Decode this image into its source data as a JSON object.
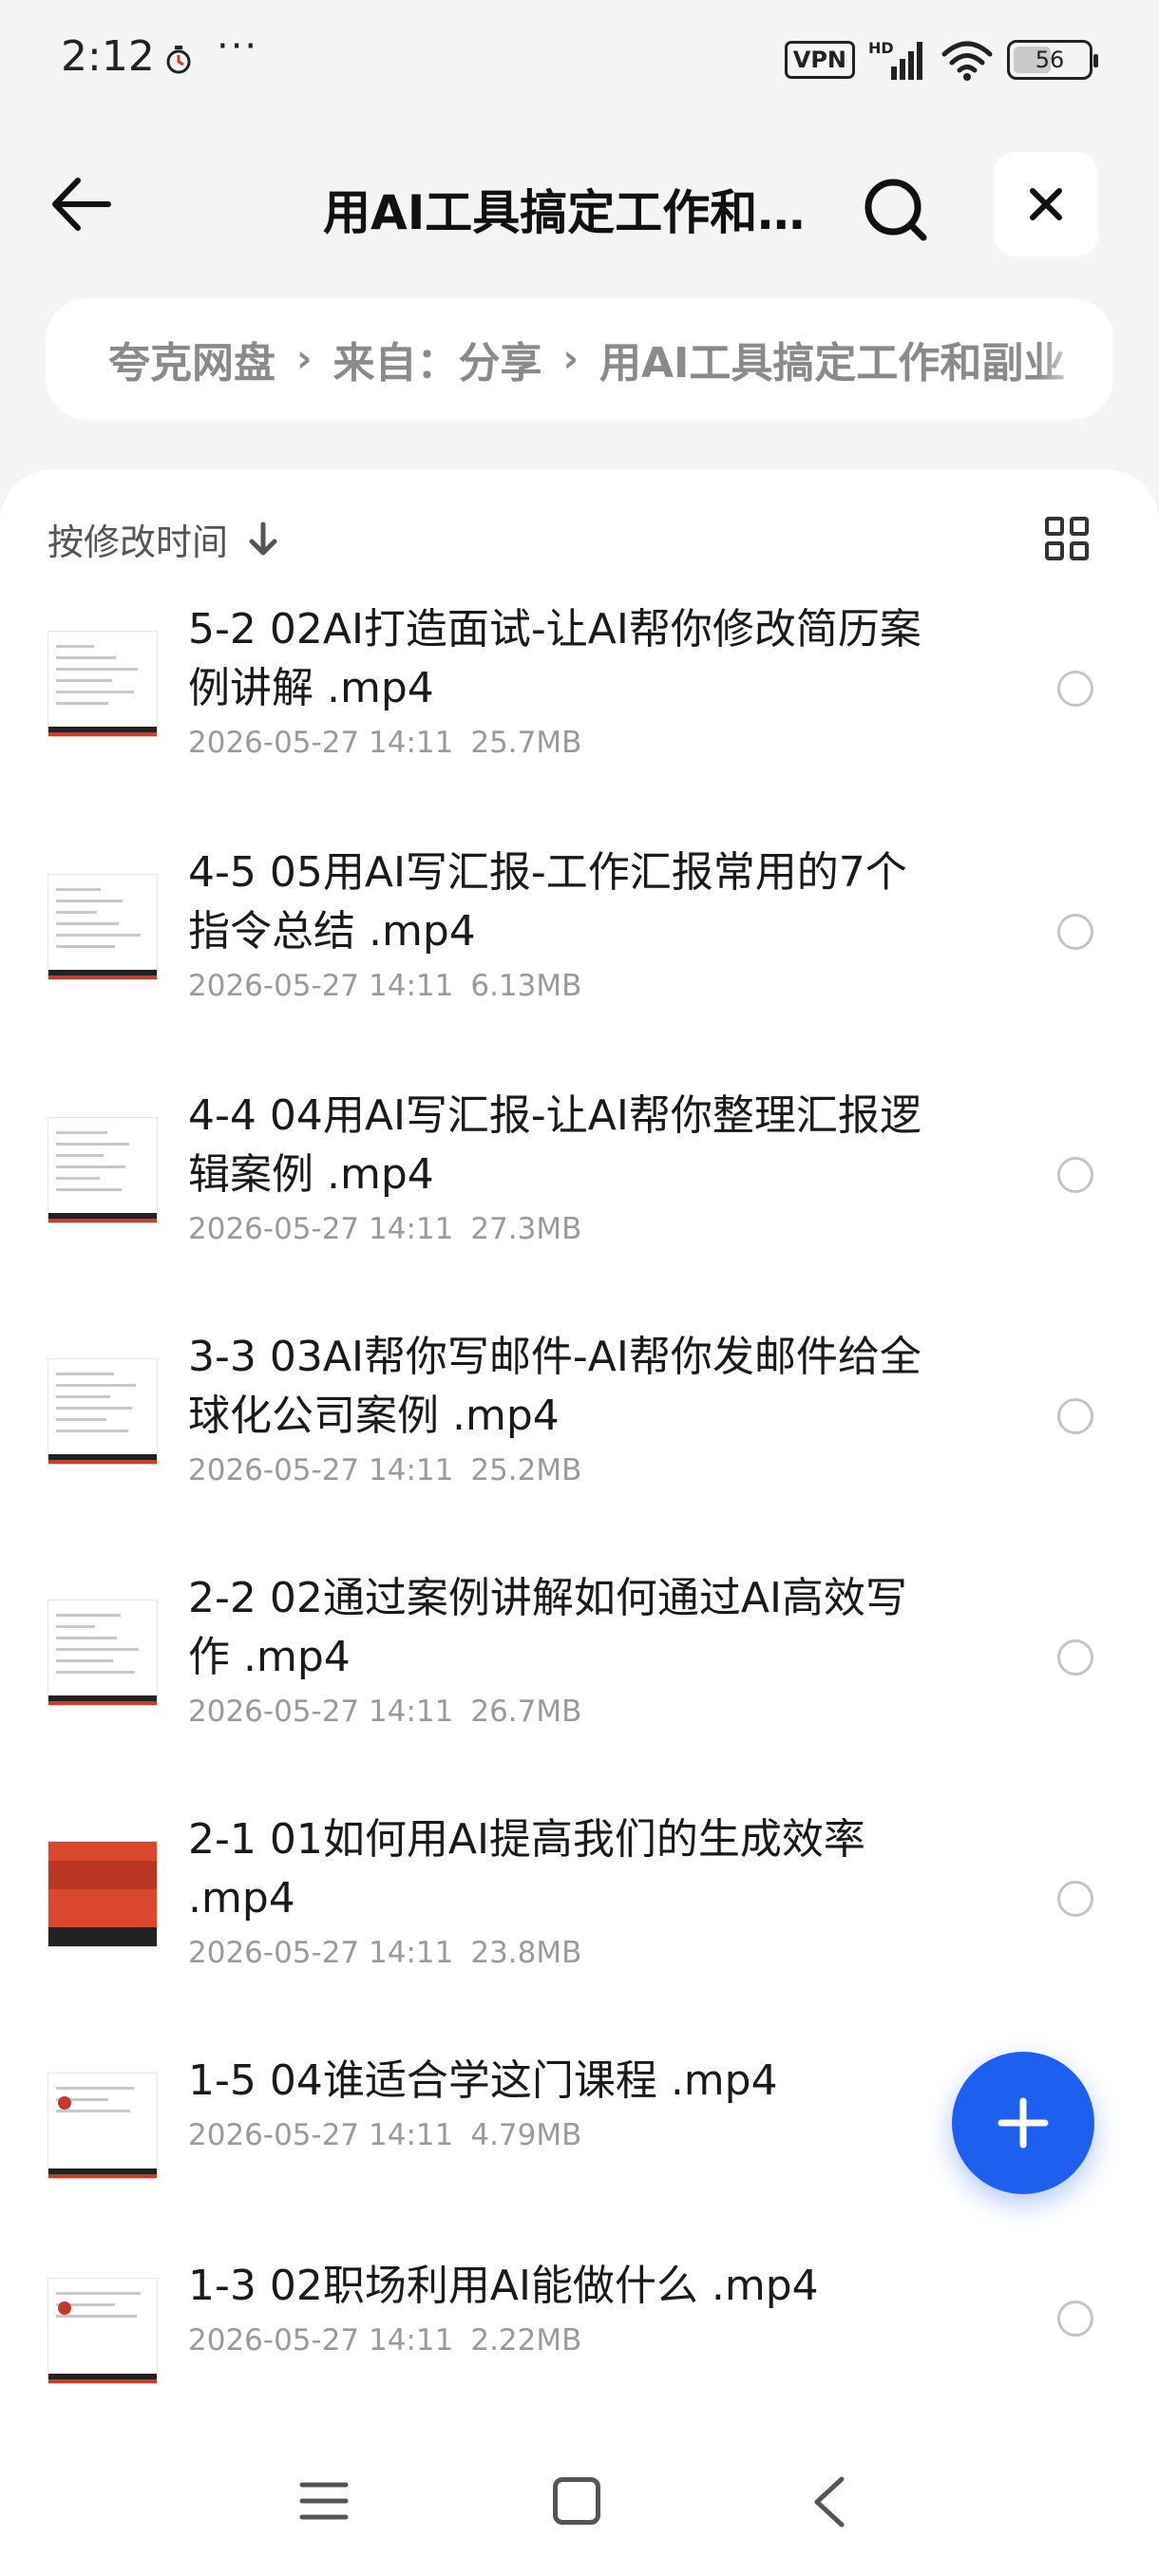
{
  "status_bar": {
    "time": "2:12",
    "dots": "···",
    "vpn": "VPN",
    "network": "HD",
    "battery": "56",
    "battery_level_pct": 56
  },
  "header": {
    "title": "用AI工具搞定工作和…",
    "back_icon": "arrow-left-icon",
    "search_icon": "search-icon",
    "close_icon": "close-icon"
  },
  "breadcrumb": {
    "items": [
      "夸克网盘",
      "来自：分享",
      "用AI工具搞定工作和副业"
    ]
  },
  "sort": {
    "label": "按修改时间",
    "direction_icon": "arrow-down-icon",
    "view_icon": "grid-view-icon"
  },
  "files": [
    {
      "name": "5-2 02AI打造面试-让AI帮你修改简历案例讲解 .mp4",
      "date": "2026-05-27 14:11",
      "size": "25.7MB",
      "thumb": "doc"
    },
    {
      "name": "4-5 05用AI写汇报-工作汇报常用的7个指令总结 .mp4",
      "date": "2026-05-27 14:11",
      "size": "6.13MB",
      "thumb": "doc"
    },
    {
      "name": "4-4 04用AI写汇报-让AI帮你整理汇报逻辑案例 .mp4",
      "date": "2026-05-27 14:11",
      "size": "27.3MB",
      "thumb": "doc"
    },
    {
      "name": "3-3 03AI帮你写邮件-AI帮你发邮件给全球化公司案例 .mp4",
      "date": "2026-05-27 14:11",
      "size": "25.2MB",
      "thumb": "doc"
    },
    {
      "name": "2-2 02通过案例讲解如何通过AI高效写作 .mp4",
      "date": "2026-05-27 14:11",
      "size": "26.7MB",
      "thumb": "table"
    },
    {
      "name": "2-1 01如何用AI提高我们的生成效率 .mp4",
      "date": "2026-05-27 14:11",
      "size": "23.8MB",
      "thumb": "slide"
    },
    {
      "name": "1-5 04谁适合学这门课程 .mp4",
      "date": "2026-05-27 14:11",
      "size": "4.79MB",
      "thumb": "list"
    },
    {
      "name": "1-3 02职场利用AI能做什么 .mp4",
      "date": "2026-05-27 14:11",
      "size": "2.22MB",
      "thumb": "list"
    }
  ],
  "fab": {
    "icon": "plus-icon"
  },
  "nav": {
    "menu_icon": "menu-icon",
    "home_icon": "home-icon",
    "back_icon": "back-chevron-icon"
  },
  "colors": {
    "accent": "#1f5ff0",
    "background": "#f4f4f6",
    "muted_text": "#9a9a9a"
  }
}
